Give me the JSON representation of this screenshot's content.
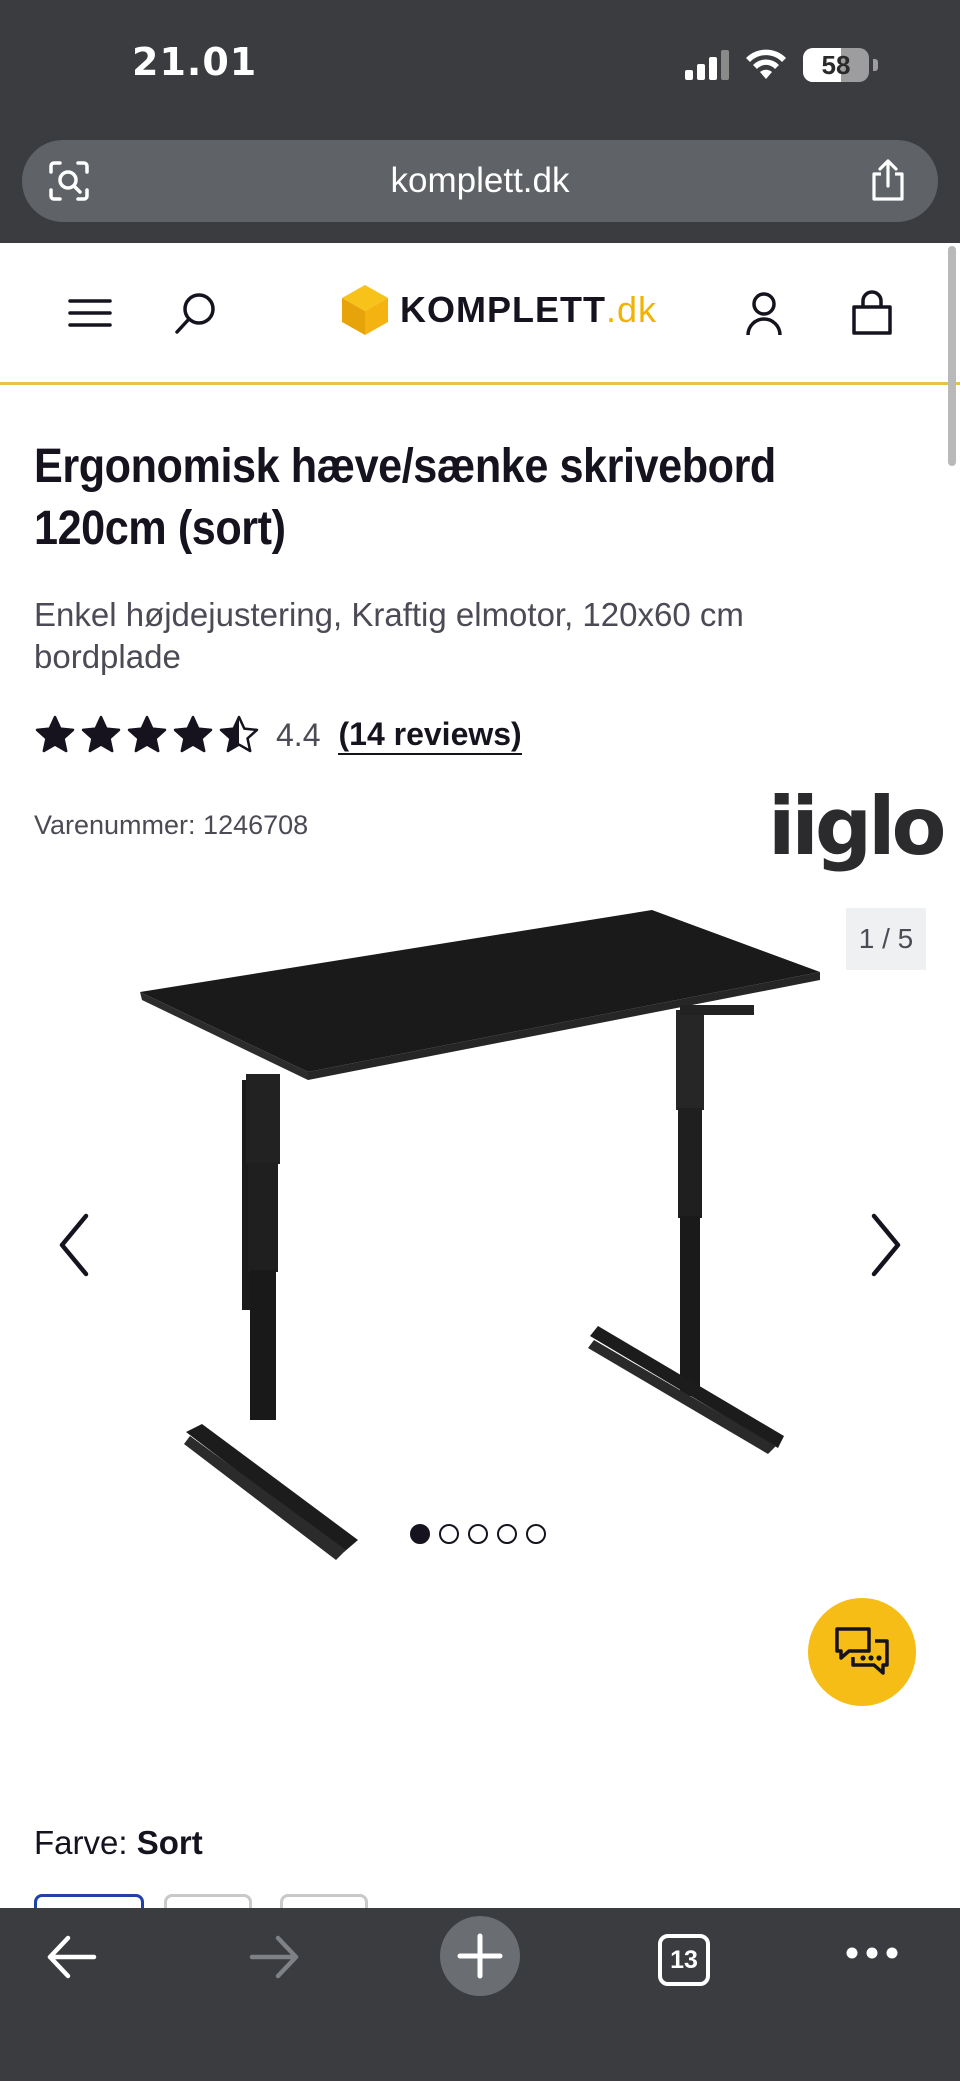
{
  "status_bar": {
    "time": "21.01",
    "battery_level": "58",
    "battery_fraction": 0.58
  },
  "browser": {
    "url": "komplett.dk",
    "open_tabs": "13"
  },
  "header": {
    "logo_text": "KOMPLETT",
    "logo_suffix": ".dk"
  },
  "product": {
    "title": "Ergonomisk hæve/sænke skrivebord 120cm (sort)",
    "subtitle": "Enkel højdejustering, Kraftig elmotor, 120x60 cm bordplade",
    "rating_value": "4.4",
    "rating_stars": 4.4,
    "reviews_label": "(14 reviews)",
    "sku": "Varenummer: 1246708",
    "brand": "iiglo",
    "image_counter": "1 / 5",
    "image_count": 5,
    "image_active_index": 0,
    "color_label": "Farve:",
    "color_value": "Sort"
  },
  "colors": {
    "accent": "#f5bd16",
    "header_bar": "#3a3c3f",
    "text": "#16131f",
    "swatch_selected": "#2041a8"
  },
  "icons": [
    "menu-icon",
    "search-icon",
    "user-icon",
    "cart-icon",
    "chevron-left-icon",
    "chevron-right-icon",
    "chat-icon",
    "back-icon",
    "forward-icon",
    "plus-icon",
    "more-icon",
    "share-icon",
    "lens-icon"
  ]
}
